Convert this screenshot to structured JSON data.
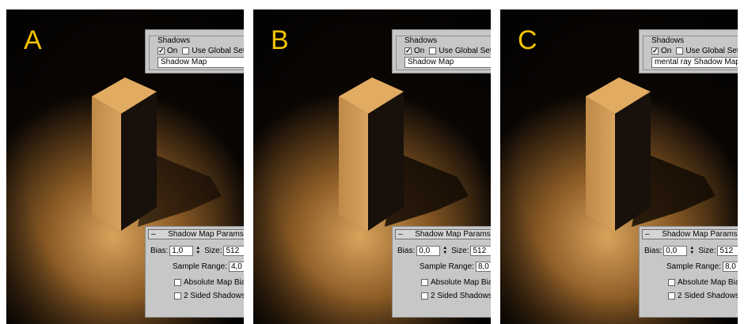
{
  "panels": [
    {
      "letter": "A",
      "shadows": {
        "title": "Shadows",
        "on_label": "On",
        "on_checked": true,
        "global_label": "Use Global Settings",
        "global_checked": false,
        "type": "Shadow Map"
      },
      "params": {
        "title": "Shadow Map Params",
        "bias_label": "Bias:",
        "bias": "1,0",
        "size_label": "Size:",
        "size": "512",
        "range_label": "Sample Range:",
        "range": "4,0",
        "absolute_label": "Absolute Map Bias",
        "two_sided_label": "2 Sided Shadows"
      }
    },
    {
      "letter": "B",
      "shadows": {
        "title": "Shadows",
        "on_label": "On",
        "on_checked": true,
        "global_label": "Use Global Settings",
        "global_checked": false,
        "type": "Shadow Map"
      },
      "params": {
        "title": "Shadow Map Params",
        "bias_label": "Bias:",
        "bias": "0,0",
        "size_label": "Size:",
        "size": "512",
        "range_label": "Sample Range:",
        "range": "8,0",
        "absolute_label": "Absolute Map Bias",
        "two_sided_label": "2 Sided Shadows"
      }
    },
    {
      "letter": "C",
      "shadows": {
        "title": "Shadows",
        "on_label": "On",
        "on_checked": true,
        "global_label": "Use Global Settings",
        "global_checked": false,
        "type": "mental ray Shadow Map"
      },
      "params": {
        "title": "Shadow Map Params",
        "bias_label": "Bias:",
        "bias": "0,0",
        "size_label": "Size:",
        "size": "512",
        "range_label": "Sample Range:",
        "range": "8,0",
        "absolute_label": "Absolute Map Bias",
        "two_sided_label": "2 Sided Shadows"
      }
    }
  ],
  "colors": {
    "letter": "#f2c200",
    "ui_panel": "#c7c7c7",
    "light": "#d9a35c"
  }
}
